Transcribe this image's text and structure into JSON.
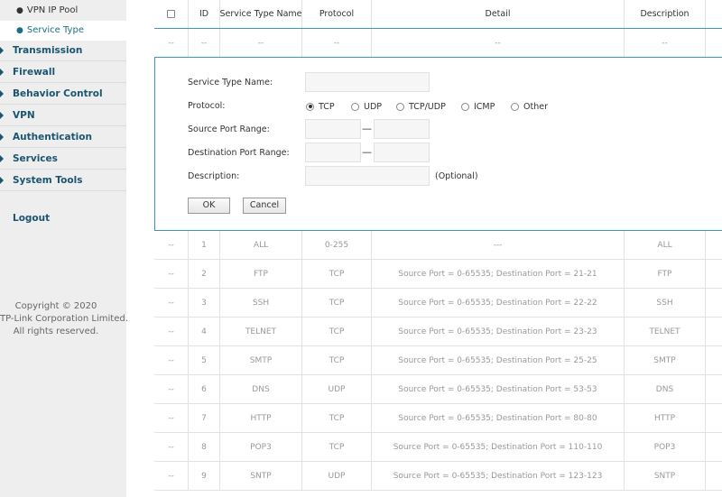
{
  "sidebar": {
    "sub_items": [
      {
        "label": "VPN IP Pool",
        "active": false
      },
      {
        "label": "Service Type",
        "active": true
      }
    ],
    "menu": [
      "Transmission",
      "Firewall",
      "Behavior Control",
      "VPN",
      "Authentication",
      "Services",
      "System Tools"
    ],
    "logout": "Logout",
    "copyright": [
      "Copyright © 2020",
      "TP-Link Corporation Limited.",
      "All rights reserved."
    ]
  },
  "table": {
    "headers": [
      "",
      "ID",
      "Service Type Name",
      "Protocol",
      "Detail",
      "Description"
    ],
    "placeholder_row": [
      "--",
      "--",
      "--",
      "--",
      "--",
      "--"
    ],
    "rows": [
      {
        "select": "--",
        "id": "1",
        "name": "ALL",
        "protocol": "0-255",
        "detail": "---",
        "description": "ALL"
      },
      {
        "select": "--",
        "id": "2",
        "name": "FTP",
        "protocol": "TCP",
        "detail": "Source Port = 0-65535; Destination Port = 21-21",
        "description": "FTP"
      },
      {
        "select": "--",
        "id": "3",
        "name": "SSH",
        "protocol": "TCP",
        "detail": "Source Port = 0-65535; Destination Port = 22-22",
        "description": "SSH"
      },
      {
        "select": "--",
        "id": "4",
        "name": "TELNET",
        "protocol": "TCP",
        "detail": "Source Port = 0-65535; Destination Port = 23-23",
        "description": "TELNET"
      },
      {
        "select": "--",
        "id": "5",
        "name": "SMTP",
        "protocol": "TCP",
        "detail": "Source Port = 0-65535; Destination Port = 25-25",
        "description": "SMTP"
      },
      {
        "select": "--",
        "id": "6",
        "name": "DNS",
        "protocol": "UDP",
        "detail": "Source Port = 0-65535; Destination Port = 53-53",
        "description": "DNS"
      },
      {
        "select": "--",
        "id": "7",
        "name": "HTTP",
        "protocol": "TCP",
        "detail": "Source Port = 0-65535; Destination Port = 80-80",
        "description": "HTTP"
      },
      {
        "select": "--",
        "id": "8",
        "name": "POP3",
        "protocol": "TCP",
        "detail": "Source Port = 0-65535; Destination Port = 110-110",
        "description": "POP3"
      },
      {
        "select": "--",
        "id": "9",
        "name": "SNTP",
        "protocol": "UDP",
        "detail": "Source Port = 0-65535; Destination Port = 123-123",
        "description": "SNTP"
      }
    ]
  },
  "form": {
    "service_type_name_label": "Service Type Name:",
    "service_type_name_value": "",
    "protocol_label": "Protocol:",
    "protocols": [
      "TCP",
      "UDP",
      "TCP/UDP",
      "ICMP",
      "Other"
    ],
    "selected_protocol": "TCP",
    "source_port_label": "Source Port Range:",
    "source_port_from": "",
    "source_port_to": "",
    "destination_port_label": "Destination Port Range:",
    "destination_port_from": "",
    "destination_port_to": "",
    "port_separator": "—",
    "description_label": "Description:",
    "description_value": "",
    "optional_hint": "(Optional)",
    "ok_label": "OK",
    "cancel_label": "Cancel"
  },
  "colors": {
    "accent": "#3a98b9",
    "sidebar_bg": "#eeeeee",
    "menu_text": "#1a5570"
  }
}
